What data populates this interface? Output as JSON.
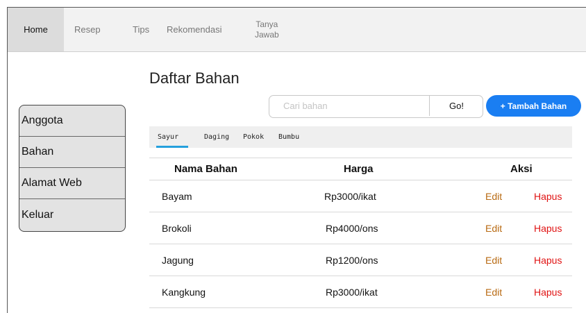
{
  "nav": {
    "items": [
      {
        "label": "Home"
      },
      {
        "label": "Resep"
      },
      {
        "label": "Tips"
      },
      {
        "label": "Rekomendasi"
      }
    ],
    "tanya_line1": "Tanya",
    "tanya_line2": "Jawab",
    "active": "Home"
  },
  "page_title": "Daftar Bahan",
  "sidebar": {
    "items": [
      {
        "label": "Anggota"
      },
      {
        "label": "Bahan"
      },
      {
        "label": "Alamat Web"
      },
      {
        "label": "Keluar"
      }
    ]
  },
  "search": {
    "placeholder": "Cari bahan",
    "value": "",
    "go_label": "Go!"
  },
  "add_button_label": "+ Tambah Bahan",
  "tabs": {
    "items": [
      {
        "label": "Sayur"
      },
      {
        "label": "Daging"
      },
      {
        "label": "Pokok"
      },
      {
        "label": "Bumbu"
      }
    ],
    "active": "Sayur"
  },
  "table": {
    "headers": [
      "Nama Bahan",
      "Harga",
      "Aksi"
    ],
    "rows": [
      {
        "name": "Bayam",
        "price": "Rp3000/ikat",
        "edit": "Edit",
        "delete": "Hapus"
      },
      {
        "name": "Brokoli",
        "price": "Rp4000/ons",
        "edit": "Edit",
        "delete": "Hapus"
      },
      {
        "name": "Jagung",
        "price": "Rp1200/ons",
        "edit": "Edit",
        "delete": "Hapus"
      },
      {
        "name": "Kangkung",
        "price": "Rp3000/ikat",
        "edit": "Edit",
        "delete": "Hapus"
      }
    ]
  },
  "colors": {
    "accent": "#1a7ef2",
    "tab_underline": "#25a0dd",
    "edit": "#b86a12",
    "delete": "#e01313"
  }
}
